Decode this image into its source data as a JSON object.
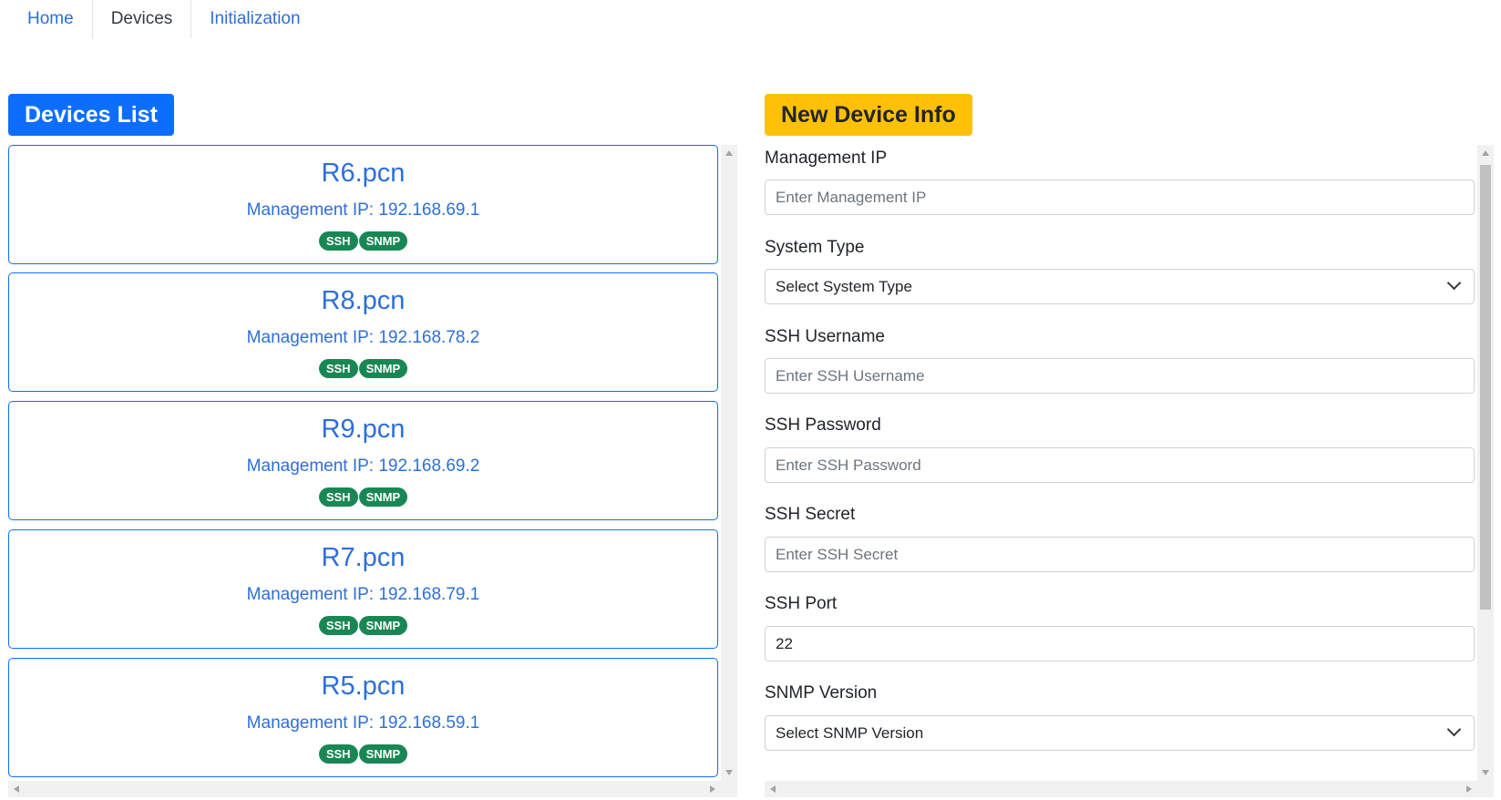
{
  "nav": {
    "items": [
      {
        "label": "Home",
        "active": false
      },
      {
        "label": "Devices",
        "active": true
      },
      {
        "label": "Initialization",
        "active": false
      }
    ]
  },
  "devices_section": {
    "title": "Devices List",
    "devices": [
      {
        "name": "R6.pcn",
        "ip_label": "Management IP: 192.168.69.1",
        "badges": [
          "SSH",
          "SNMP"
        ]
      },
      {
        "name": "R8.pcn",
        "ip_label": "Management IP: 192.168.78.2",
        "badges": [
          "SSH",
          "SNMP"
        ]
      },
      {
        "name": "R9.pcn",
        "ip_label": "Management IP: 192.168.69.2",
        "badges": [
          "SSH",
          "SNMP"
        ]
      },
      {
        "name": "R7.pcn",
        "ip_label": "Management IP: 192.168.79.1",
        "badges": [
          "SSH",
          "SNMP"
        ]
      },
      {
        "name": "R5.pcn",
        "ip_label": "Management IP: 192.168.59.1",
        "badges": [
          "SSH",
          "SNMP"
        ]
      }
    ]
  },
  "new_device": {
    "title": "New Device Info",
    "fields": {
      "management_ip": {
        "label": "Management IP",
        "placeholder": "Enter Management IP",
        "value": ""
      },
      "system_type": {
        "label": "System Type",
        "selected": "Select System Type"
      },
      "ssh_username": {
        "label": "SSH Username",
        "placeholder": "Enter SSH Username",
        "value": ""
      },
      "ssh_password": {
        "label": "SSH Password",
        "placeholder": "Enter SSH Password",
        "value": ""
      },
      "ssh_secret": {
        "label": "SSH Secret",
        "placeholder": "Enter SSH Secret",
        "value": ""
      },
      "ssh_port": {
        "label": "SSH Port",
        "value": "22"
      },
      "snmp_version": {
        "label": "SNMP Version",
        "selected": "Select SNMP Version"
      }
    }
  },
  "colors": {
    "primary": "#0d6efd",
    "warning": "#ffc107",
    "success": "#198754",
    "link": "#2d6fdb"
  }
}
